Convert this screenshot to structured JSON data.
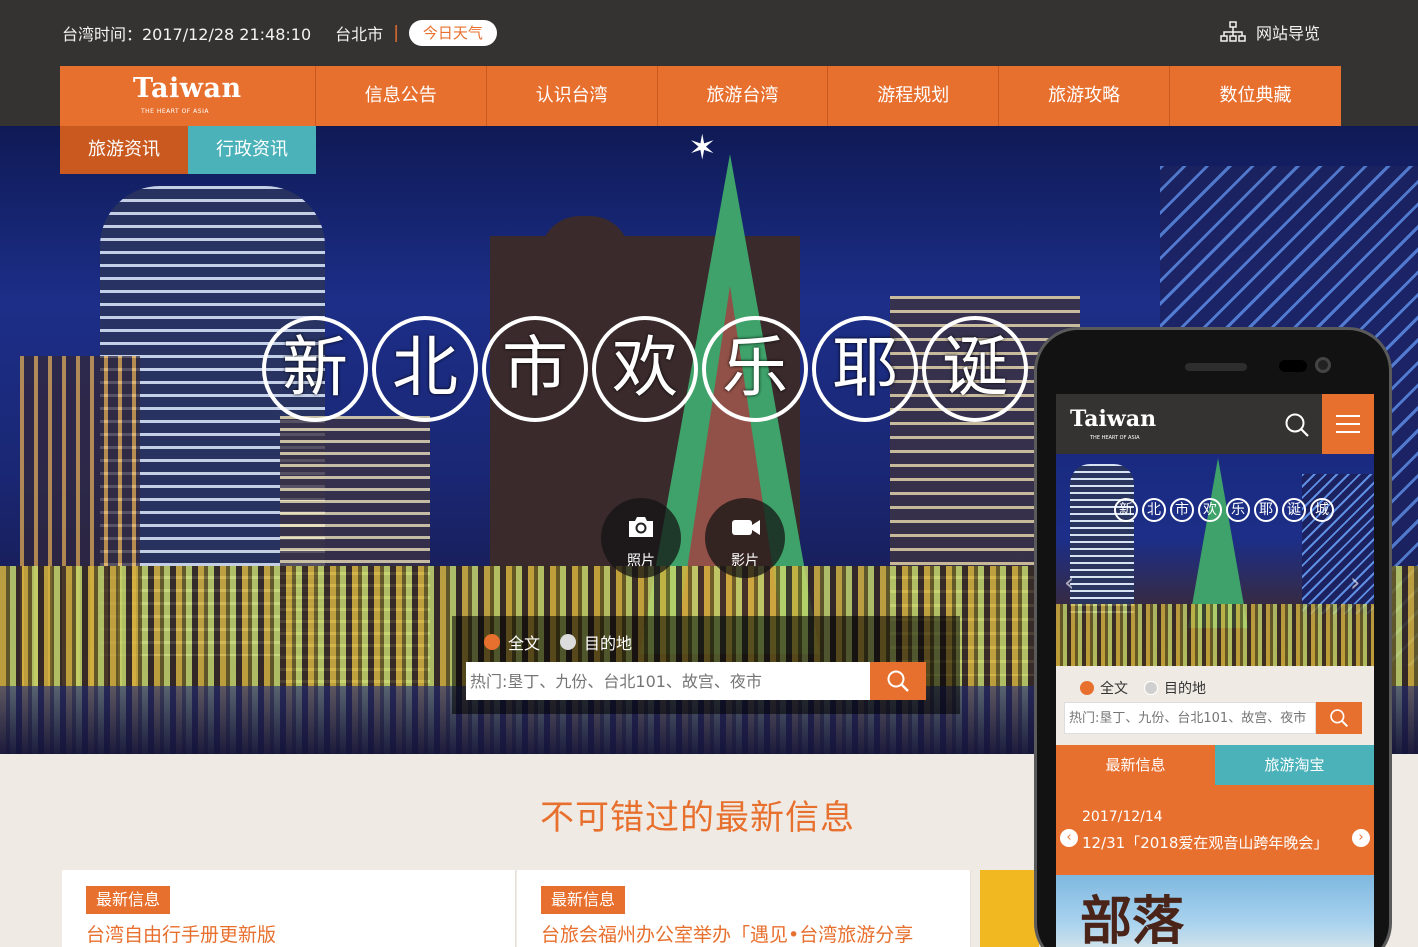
{
  "topbar": {
    "time_label": "台湾时间：2017/12/28 21:48:10",
    "city": "台北市",
    "separator": "|",
    "weather_button": "今日天气",
    "sitemap_label": "网站导览"
  },
  "nav": {
    "logo_main": "Taiwan",
    "logo_sub": "THE HEART OF ASIA",
    "items": [
      "信息公告",
      "认识台湾",
      "旅游台湾",
      "游程规划",
      "旅游攻略",
      "数位典藏"
    ]
  },
  "subtabs": [
    "旅游资讯",
    "行政资讯"
  ],
  "hero": {
    "title_chars": [
      "新",
      "北",
      "市",
      "欢",
      "乐",
      "耶",
      "诞"
    ],
    "photo_label": "照片",
    "video_label": "影片",
    "radio_all": "全文",
    "radio_dest": "目的地",
    "search_placeholder": "热门:垦丁、九份、台北101、故宫、夜市"
  },
  "news": {
    "section_title": "不可错过的最新信息",
    "cards": [
      {
        "badge": "最新信息",
        "title": "台湾自由行手册更新版"
      },
      {
        "badge": "最新信息",
        "title": "台旅会福州办公室举办「遇见•台湾旅游分享"
      }
    ]
  },
  "mobile": {
    "logo_main": "Taiwan",
    "logo_sub": "THE HEART OF ASIA",
    "hero_chars": [
      "新",
      "北",
      "市",
      "欢",
      "乐",
      "耶",
      "诞",
      "城"
    ],
    "prev_arrow": "‹",
    "next_arrow": "›",
    "radio_all": "全文",
    "radio_dest": "目的地",
    "search_placeholder": "热门:垦丁、九份、台北101、故宫、夜市",
    "tabs": [
      "最新信息",
      "旅游淘宝"
    ],
    "news_date": "2017/12/14",
    "news_title": "12/31「2018爱在观音山跨年晚会」",
    "news_prev": "‹",
    "news_next": "›",
    "image_text": "部落"
  },
  "colors": {
    "accent": "#e8702f",
    "teal": "#4bb2ba",
    "dark": "#353331",
    "background": "#efebe4"
  }
}
